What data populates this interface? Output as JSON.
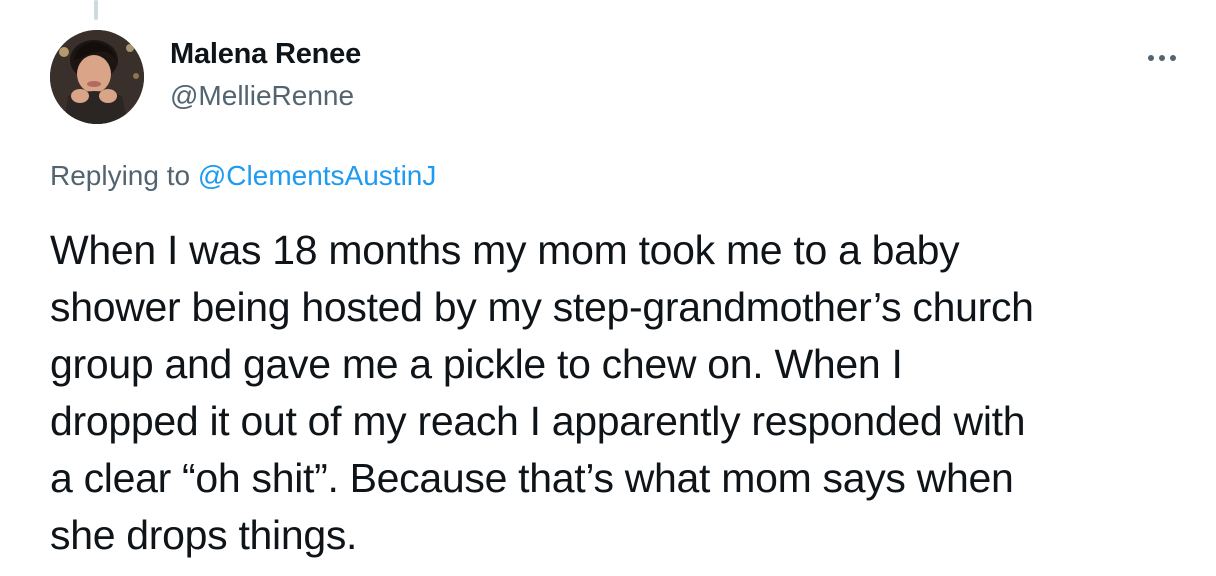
{
  "tweet": {
    "author": {
      "name": "Malena Renee",
      "handle": "@MellieRenne"
    },
    "replying_prefix": "Replying to ",
    "replying_to": "@ClementsAustinJ",
    "text_lines": [
      "When I was 18 months my mom took me to a baby",
      "shower being hosted by my step-grandmother’s church",
      "group and gave me a pickle to chew on. When I",
      "dropped it out of my reach I apparently responded with",
      "a clear “oh shit”. Because that’s what mom says when",
      "she drops things."
    ]
  },
  "icons": {
    "more": "more-horizontal-icon",
    "avatar": "profile-photo"
  },
  "colors": {
    "text_primary": "#0f1419",
    "text_secondary": "#536471",
    "link": "#1d9bf0",
    "thread_line": "#cfd9de"
  }
}
